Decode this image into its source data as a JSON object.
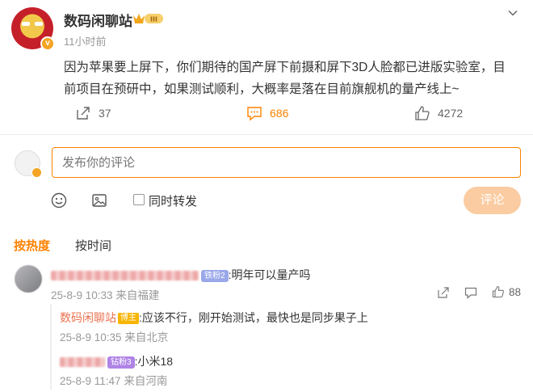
{
  "post": {
    "username": "数码闲聊站",
    "level_badge": "III",
    "timestamp": "11小时前",
    "text": "因为苹果要上屏下，你们期待的国产屏下前摄和屏下3D人脸都已进版实验室，目前项目在预研中，如果测试顺利，大概率是落在目前旗舰机的量产线上~",
    "verified_mark": "v"
  },
  "actions": {
    "share_count": "37",
    "comment_count": "686",
    "like_count": "4272"
  },
  "composer": {
    "placeholder": "发布你的评论",
    "repost_label": "同时转发",
    "submit_label": "评论"
  },
  "sort": {
    "hot_label": "按热度",
    "time_label": "按时间"
  },
  "comments": [
    {
      "username": "用户名已模糊_97337",
      "fan_badge": "铁粉2",
      "text": ":明年可以量产吗",
      "date": "25-8-9 10:33",
      "location": "来自福建",
      "likes": "88",
      "replies": [
        {
          "username": "数码闲聊站",
          "tag": "博主",
          "text": ":应该不行，刚开始测试，最快也是同步果子上",
          "date": "25-8-9 10:35",
          "location": "来自北京"
        },
        {
          "username": "用户名已模糊",
          "fan_badge": "钻粉3",
          "text": ":小米18",
          "date": "25-8-9 11:47",
          "location": "来自河南"
        }
      ]
    }
  ],
  "colors": {
    "accent": "#ff8200",
    "author": "#eb7350",
    "muted": "#999999",
    "submit_bg": "#fbcba1"
  }
}
